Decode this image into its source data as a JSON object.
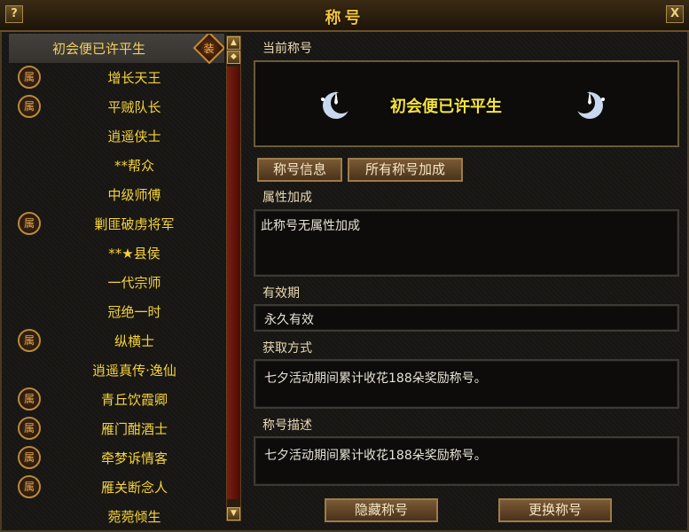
{
  "window": {
    "title": "称号",
    "help_label": "?",
    "close_label": "X"
  },
  "title_list": {
    "items": [
      {
        "label": "初会便已许平生",
        "badge": "",
        "selected": true,
        "equipped_badge": "装"
      },
      {
        "label": "增长天王",
        "badge": "属"
      },
      {
        "label": "平贼队长",
        "badge": "属"
      },
      {
        "label": "逍遥侠士",
        "badge": ""
      },
      {
        "label": "**帮众",
        "badge": ""
      },
      {
        "label": "中级师傅",
        "badge": ""
      },
      {
        "label": "剿匪破虏将军",
        "badge": "属"
      },
      {
        "label": "**★县侯",
        "badge": ""
      },
      {
        "label": "一代宗师",
        "badge": ""
      },
      {
        "label": "冠绝一时",
        "badge": ""
      },
      {
        "label": "纵横士",
        "badge": "属"
      },
      {
        "label": "逍遥真传·逸仙",
        "badge": ""
      },
      {
        "label": "青丘饮霞卿",
        "badge": "属"
      },
      {
        "label": "雁门酣酒士",
        "badge": "属"
      },
      {
        "label": "牵梦诉情客",
        "badge": "属"
      },
      {
        "label": "雁关断念人",
        "badge": "属"
      },
      {
        "label": "菀菀倾生",
        "badge": ""
      }
    ]
  },
  "detail": {
    "current_title_label": "当前称号",
    "current_title_name": "初会便已许平生",
    "tab_info": "称号信息",
    "tab_all_bonus": "所有称号加成",
    "attr_label": "属性加成",
    "attr_value": "此称号无属性加成",
    "validity_label": "有效期",
    "validity_value": "永久有效",
    "obtain_label": "获取方式",
    "obtain_value": "七夕活动期间累计收花188朵奖励称号。",
    "desc_label": "称号描述",
    "desc_value": "七夕活动期间累计收花188朵奖励称号。",
    "hide_button": "隐藏称号",
    "change_button": "更换称号"
  }
}
